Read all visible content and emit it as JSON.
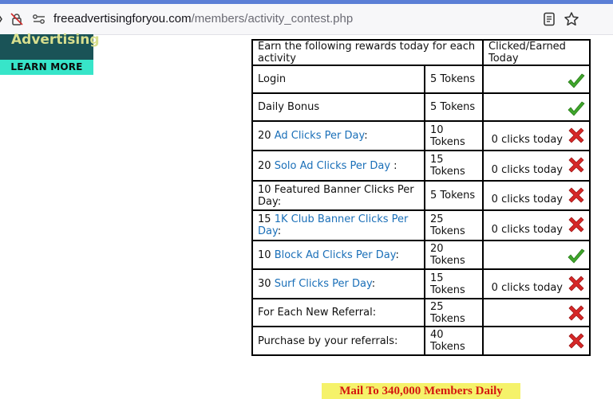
{
  "browser": {
    "url_domain": "freeadvertisingforyou.com",
    "url_path": "/members/activity_contest.php",
    "icons": [
      "lock-icon",
      "permissions-icon",
      "reader-view-icon",
      "bookmark-star-icon"
    ]
  },
  "ad": {
    "title": "Advertising",
    "cta": "LEARN MORE"
  },
  "table": {
    "header_activity": "Earn the following rewards today for each activity",
    "header_status": "Clicked/Earned Today",
    "rows": [
      {
        "count": "",
        "label": "Login",
        "suffix": "",
        "reward": "5 Tokens",
        "note": "",
        "status": "earned"
      },
      {
        "count": "",
        "label": "Daily Bonus",
        "suffix": "",
        "reward": "5 Tokens",
        "note": "",
        "status": "earned"
      },
      {
        "count": "20",
        "label": "Ad Clicks Per Day",
        "suffix": ":",
        "reward": "10 Tokens",
        "note": "0 clicks today",
        "status": "not-earned"
      },
      {
        "count": "20",
        "label": "Solo Ad Clicks Per Day",
        "suffix": " :",
        "reward": "15 Tokens",
        "note": "0 clicks today",
        "status": "not-earned"
      },
      {
        "count": "",
        "label": "10 Featured Banner Clicks Per Day:",
        "suffix": "",
        "reward": "5 Tokens",
        "note": "0 clicks today",
        "status": "not-earned"
      },
      {
        "count": "15",
        "label": "1K Club Banner Clicks Per Day",
        "suffix": ":",
        "reward": "25 Tokens",
        "note": "0 clicks today",
        "status": "not-earned"
      },
      {
        "count": "10",
        "label": "Block Ad Clicks Per Day",
        "suffix": ":",
        "reward": "20 Tokens",
        "note": "",
        "status": "earned"
      },
      {
        "count": "30",
        "label": "Surf Clicks Per Day",
        "suffix": ":",
        "reward": "15 Tokens",
        "note": "0 clicks today",
        "status": "not-earned"
      },
      {
        "count": "",
        "label": "For Each New Referral:",
        "suffix": "",
        "reward": "25 Tokens",
        "note": "",
        "status": "not-earned"
      },
      {
        "count": "",
        "label": "Purchase by your referrals:",
        "suffix": "",
        "reward": "40 Tokens",
        "note": "",
        "status": "not-earned"
      }
    ]
  },
  "banner": {
    "text": "Mail To 340,000 Members Daily"
  },
  "colors": {
    "link": "#1a6fb8",
    "check": "#3fa62b",
    "cross": "#d62828",
    "ad_background": "#1a5357",
    "ad_cta": "#37e5c9",
    "banner_background": "#f5f26a",
    "banner_text": "#d4180f"
  }
}
